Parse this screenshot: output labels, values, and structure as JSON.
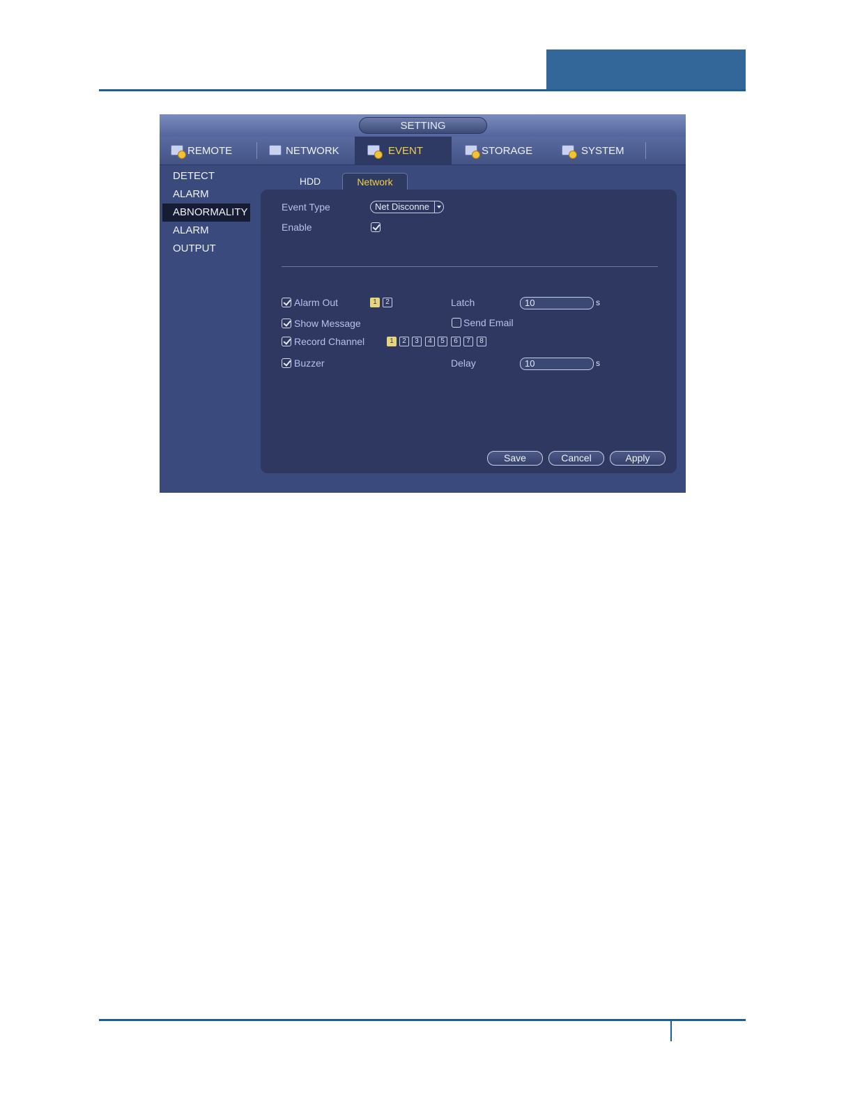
{
  "window": {
    "title": "SETTING"
  },
  "main_tabs": [
    {
      "label": "REMOTE",
      "icon": "remote-gear-icon"
    },
    {
      "label": "NETWORK",
      "icon": "network-icon"
    },
    {
      "label": "EVENT",
      "icon": "event-icon"
    },
    {
      "label": "STORAGE",
      "icon": "storage-icon"
    },
    {
      "label": "SYSTEM",
      "icon": "system-icon"
    }
  ],
  "active_main_tab": "EVENT",
  "sidebar": {
    "items": [
      "DETECT",
      "ALARM",
      "ABNORMALITY",
      "ALARM OUTPUT"
    ],
    "active": "ABNORMALITY"
  },
  "sub_tabs": [
    "HDD",
    "Network"
  ],
  "active_sub_tab": "Network",
  "form": {
    "event_type_label": "Event Type",
    "event_type_value": "Net Disconne",
    "enable_label": "Enable",
    "enable_checked": true,
    "alarm_out_label": "Alarm Out",
    "alarm_out_checked": true,
    "alarm_out_channels": [
      "1",
      "2"
    ],
    "latch_label": "Latch",
    "latch_value": "10",
    "latch_unit": "s",
    "show_message_label": "Show Message",
    "show_message_checked": true,
    "send_email_label": "Send Email",
    "send_email_checked": false,
    "record_channel_label": "Record Channel",
    "record_channel_checked": true,
    "record_channels": [
      "1",
      "2",
      "3",
      "4",
      "5",
      "6",
      "7",
      "8"
    ],
    "buzzer_label": "Buzzer",
    "buzzer_checked": true,
    "delay_label": "Delay",
    "delay_value": "10",
    "delay_unit": "s"
  },
  "buttons": {
    "save": "Save",
    "cancel": "Cancel",
    "apply": "Apply"
  },
  "colors": {
    "page_rule": "#1f5d95",
    "header_block": "#336699",
    "window_bg": "#3a4a7c",
    "panel_bg": "#2e3860",
    "active_tab_text": "#f2d04a"
  }
}
